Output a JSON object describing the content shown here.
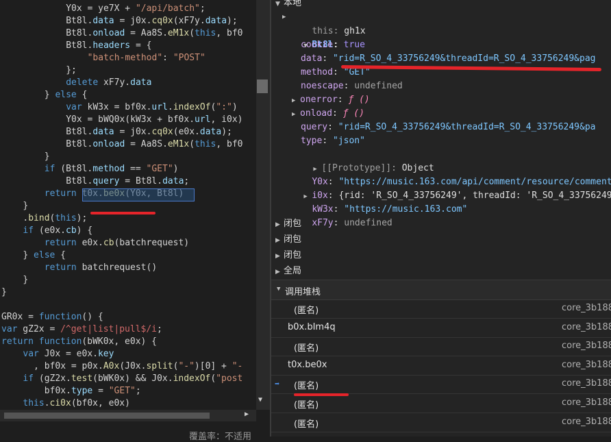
{
  "code": {
    "lines": [
      {
        "indent": 12,
        "tokens": [
          [
            "t-var",
            "Y0x = ye7X + "
          ],
          [
            "t-str",
            "\"/api/batch\""
          ],
          [
            "t-pun",
            ";"
          ]
        ]
      },
      {
        "indent": 12,
        "tokens": [
          [
            "t-var",
            "Bt8l."
          ],
          [
            "t-prop",
            "data"
          ],
          [
            "t-var",
            " = j0x."
          ],
          [
            "t-fn",
            "cq0x"
          ],
          [
            "t-var",
            "(xF7y."
          ],
          [
            "t-prop",
            "data"
          ],
          [
            "t-var",
            ");"
          ]
        ]
      },
      {
        "indent": 12,
        "tokens": [
          [
            "t-var",
            "Bt8l."
          ],
          [
            "t-prop",
            "onload"
          ],
          [
            "t-var",
            " = Aa8S."
          ],
          [
            "t-fn",
            "eM1x"
          ],
          [
            "t-var",
            "("
          ],
          [
            "t-key",
            "this"
          ],
          [
            "t-var",
            ", bf0"
          ]
        ]
      },
      {
        "indent": 12,
        "tokens": [
          [
            "t-var",
            "Bt8l."
          ],
          [
            "t-prop",
            "headers"
          ],
          [
            "t-var",
            " = {"
          ]
        ]
      },
      {
        "indent": 16,
        "tokens": [
          [
            "t-str",
            "\"batch-method\""
          ],
          [
            "t-var",
            ": "
          ],
          [
            "t-str",
            "\"POST\""
          ]
        ]
      },
      {
        "indent": 12,
        "tokens": [
          [
            "t-var",
            "};"
          ]
        ]
      },
      {
        "indent": 12,
        "tokens": [
          [
            "t-key",
            "delete"
          ],
          [
            "t-var",
            " xF7y."
          ],
          [
            "t-prop",
            "data"
          ]
        ]
      },
      {
        "indent": 8,
        "tokens": [
          [
            "t-var",
            "} "
          ],
          [
            "t-key",
            "else"
          ],
          [
            "t-var",
            " {"
          ]
        ]
      },
      {
        "indent": 12,
        "tokens": [
          [
            "t-key",
            "var"
          ],
          [
            "t-var",
            " kW3x = bf0x."
          ],
          [
            "t-prop",
            "url"
          ],
          [
            "t-var",
            "."
          ],
          [
            "t-fn",
            "indexOf"
          ],
          [
            "t-var",
            "("
          ],
          [
            "t-str",
            "\":\""
          ],
          [
            "t-var",
            ")"
          ]
        ]
      },
      {
        "indent": 12,
        "tokens": [
          [
            "t-var",
            "Y0x = bWQ0x(kW3x + bf0x."
          ],
          [
            "t-prop",
            "url"
          ],
          [
            "t-var",
            ", i0x)"
          ]
        ]
      },
      {
        "indent": 12,
        "tokens": [
          [
            "t-var",
            "Bt8l."
          ],
          [
            "t-prop",
            "data"
          ],
          [
            "t-var",
            " = j0x."
          ],
          [
            "t-fn",
            "cq0x"
          ],
          [
            "t-var",
            "(e0x."
          ],
          [
            "t-prop",
            "data"
          ],
          [
            "t-var",
            ");"
          ]
        ]
      },
      {
        "indent": 12,
        "tokens": [
          [
            "t-var",
            "Bt8l."
          ],
          [
            "t-prop",
            "onload"
          ],
          [
            "t-var",
            " = Aa8S."
          ],
          [
            "t-fn",
            "eM1x"
          ],
          [
            "t-var",
            "("
          ],
          [
            "t-key",
            "this"
          ],
          [
            "t-var",
            ", bf0"
          ]
        ]
      },
      {
        "indent": 8,
        "tokens": [
          [
            "t-var",
            "}"
          ]
        ]
      },
      {
        "indent": 8,
        "tokens": [
          [
            "t-key",
            "if"
          ],
          [
            "t-var",
            " (Bt8l."
          ],
          [
            "t-prop",
            "method"
          ],
          [
            "t-var",
            " == "
          ],
          [
            "t-str",
            "\"GET\""
          ],
          [
            "t-var",
            ")"
          ]
        ]
      },
      {
        "indent": 12,
        "tokens": [
          [
            "t-var",
            "Bt8l."
          ],
          [
            "t-prop",
            "query"
          ],
          [
            "t-var",
            " = Bt8l."
          ],
          [
            "t-prop",
            "data"
          ],
          [
            "t-var",
            ";"
          ]
        ]
      },
      {
        "indent": 8,
        "tokens": [
          [
            "t-key",
            "return"
          ],
          [
            "t-var",
            " t0x."
          ],
          [
            "t-fn",
            "be0x"
          ],
          [
            "t-var",
            "(Y0x, Bt8l)"
          ]
        ]
      },
      {
        "indent": 4,
        "tokens": [
          [
            "t-var",
            "}"
          ]
        ]
      },
      {
        "indent": 4,
        "tokens": [
          [
            "t-var",
            "."
          ],
          [
            "t-fn",
            "bind"
          ],
          [
            "t-var",
            "("
          ],
          [
            "t-key",
            "this"
          ],
          [
            "t-var",
            ");"
          ]
        ]
      },
      {
        "indent": 4,
        "tokens": [
          [
            "t-key",
            "if"
          ],
          [
            "t-var",
            " (e0x."
          ],
          [
            "t-prop",
            "cb"
          ],
          [
            "t-var",
            ") {"
          ]
        ]
      },
      {
        "indent": 8,
        "tokens": [
          [
            "t-key",
            "return"
          ],
          [
            "t-var",
            " e0x."
          ],
          [
            "t-fn",
            "cb"
          ],
          [
            "t-var",
            "(batchrequest)"
          ]
        ]
      },
      {
        "indent": 4,
        "tokens": [
          [
            "t-var",
            "} "
          ],
          [
            "t-key",
            "else"
          ],
          [
            "t-var",
            " {"
          ]
        ]
      },
      {
        "indent": 8,
        "tokens": [
          [
            "t-key",
            "return"
          ],
          [
            "t-var",
            " batchrequest()"
          ]
        ]
      },
      {
        "indent": 4,
        "tokens": [
          [
            "t-var",
            "}"
          ]
        ]
      },
      {
        "indent": 0,
        "tokens": [
          [
            "t-var",
            "}"
          ]
        ]
      },
      {
        "indent": 0,
        "tokens": []
      },
      {
        "indent": 0,
        "tokens": [
          [
            "t-var",
            "GR0x = "
          ],
          [
            "t-key",
            "function"
          ],
          [
            "t-var",
            "() {"
          ]
        ]
      },
      {
        "indent": 0,
        "tokens": [
          [
            "t-key",
            "var"
          ],
          [
            "t-var",
            " gZ2x = "
          ],
          [
            "t-re",
            "/^get|list|pull$/i"
          ],
          [
            "t-var",
            ";"
          ]
        ]
      },
      {
        "indent": 0,
        "tokens": [
          [
            "t-key",
            "return"
          ],
          [
            "t-var",
            " "
          ],
          [
            "t-key",
            "function"
          ],
          [
            "t-var",
            "(bWK0x, e0x) {"
          ]
        ]
      },
      {
        "indent": 4,
        "tokens": [
          [
            "t-key",
            "var"
          ],
          [
            "t-var",
            " J0x = e0x."
          ],
          [
            "t-prop",
            "key"
          ]
        ]
      },
      {
        "indent": 6,
        "tokens": [
          [
            "t-var",
            ", bf0x = p0x."
          ],
          [
            "t-fn",
            "A0x"
          ],
          [
            "t-var",
            "(J0x."
          ],
          [
            "t-fn",
            "split"
          ],
          [
            "t-var",
            "("
          ],
          [
            "t-str",
            "\"-\""
          ],
          [
            "t-var",
            ")[0] + "
          ],
          [
            "t-str",
            "\"-"
          ]
        ]
      },
      {
        "indent": 4,
        "tokens": [
          [
            "t-key",
            "if"
          ],
          [
            "t-var",
            " (gZ2x."
          ],
          [
            "t-fn",
            "test"
          ],
          [
            "t-var",
            "(bWK0x) && J0x."
          ],
          [
            "t-fn",
            "indexOf"
          ],
          [
            "t-var",
            "("
          ],
          [
            "t-str",
            "\"post"
          ]
        ]
      },
      {
        "indent": 8,
        "tokens": [
          [
            "t-var",
            "bf0x."
          ],
          [
            "t-prop",
            "type"
          ],
          [
            "t-var",
            " = "
          ],
          [
            "t-str",
            "\"GET\""
          ],
          [
            "t-var",
            ";"
          ]
        ]
      },
      {
        "indent": 4,
        "tokens": [
          [
            "t-key",
            "this"
          ],
          [
            "t-var",
            "."
          ],
          [
            "t-fn",
            "ci0x"
          ],
          [
            "t-var",
            "(bf0x, e0x)"
          ]
        ]
      }
    ]
  },
  "status": {
    "coverage": "覆盖率：不适用"
  },
  "scope": {
    "local_header": "本地",
    "this_key": "this",
    "this_val": "gh1x",
    "bt8l_key": "Bt8l",
    "props": [
      {
        "key": "cookie",
        "val": "true",
        "cls": "sc-bool"
      },
      {
        "key": "data",
        "val": "\"rid=R_SO_4_33756249&threadId=R_SO_4_33756249&pag",
        "cls": "sc-str"
      },
      {
        "key": "method",
        "val": "\"GET\"",
        "cls": "sc-str"
      },
      {
        "key": "noescape",
        "val": "undefined",
        "cls": "sc-lit"
      },
      {
        "key": "onerror",
        "val": "ƒ ()",
        "cls": "sc-fn",
        "tri": true
      },
      {
        "key": "onload",
        "val": "ƒ ()",
        "cls": "sc-fn",
        "tri": true
      },
      {
        "key": "query",
        "val": "\"rid=R_SO_4_33756249&threadId=R_SO_4_33756249&pa",
        "cls": "sc-str"
      },
      {
        "key": "type",
        "val": "\"json\"",
        "cls": "sc-str"
      }
    ],
    "prototype_label": "[[Prototype]]",
    "prototype_val": "Object",
    "y0x_key": "Y0x",
    "y0x_val": "\"https://music.163.com/api/comment/resource/comments",
    "i0x_key": "i0x",
    "i0x_val": "{rid: 'R_SO_4_33756249', threadId: 'R_SO_4_33756249'",
    "kw3x_key": "kW3x",
    "kw3x_val": "\"https://music.163.com\"",
    "xf7y_key": "xF7y",
    "xf7y_val": "undefined",
    "closures": [
      "闭包",
      "闭包",
      "闭包"
    ],
    "global": "全局"
  },
  "callstack": {
    "title": "调用堆栈",
    "frames": [
      {
        "name": "(匿名)",
        "loc": "core_3b188",
        "indent": true,
        "current": false
      },
      {
        "name": "b0x.bIm4q",
        "loc": "core_3b188",
        "indent": false,
        "current": false
      },
      {
        "name": "(匿名)",
        "loc": "core_3b188",
        "indent": true,
        "current": false
      },
      {
        "name": "t0x.be0x",
        "loc": "core_3b188",
        "indent": false,
        "current": false
      },
      {
        "name": "(匿名)",
        "loc": "core_3b188",
        "indent": true,
        "current": true
      },
      {
        "name": "(匿名)",
        "loc": "core_3b188",
        "indent": true,
        "current": false
      },
      {
        "name": "(匿名)",
        "loc": "core_3b188",
        "indent": true,
        "current": false
      }
    ]
  }
}
